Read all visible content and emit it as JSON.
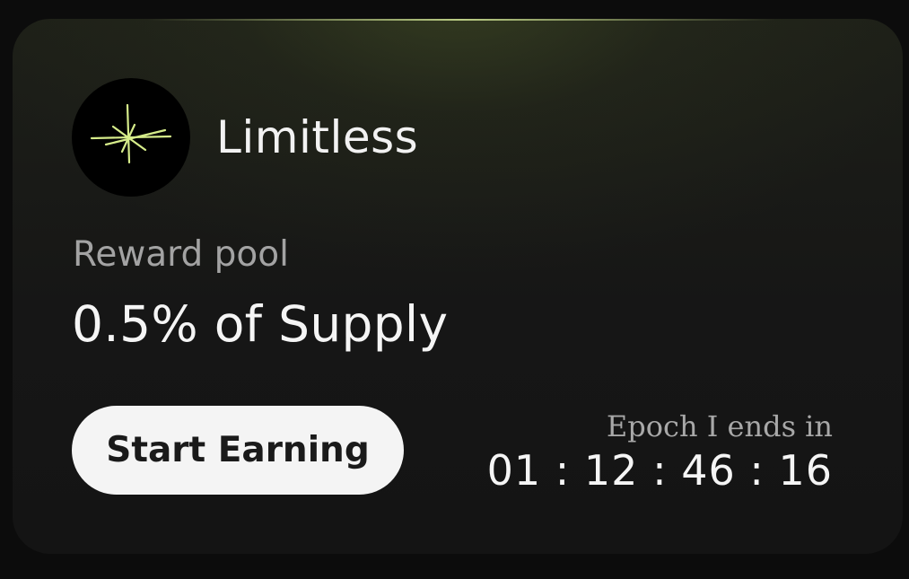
{
  "project": {
    "name": "Limitless",
    "logo_icon": "spark-star-icon",
    "logo_color": "#d6ec8a"
  },
  "reward": {
    "label": "Reward pool",
    "value": "0.5% of Supply"
  },
  "cta": {
    "label": "Start Earning"
  },
  "epoch": {
    "label": "Epoch I ends in",
    "countdown": "01 : 12 : 46 : 16"
  },
  "colors": {
    "accent": "#d6ec8a",
    "card_background": "#161616",
    "button_background": "#f4f4f4"
  }
}
